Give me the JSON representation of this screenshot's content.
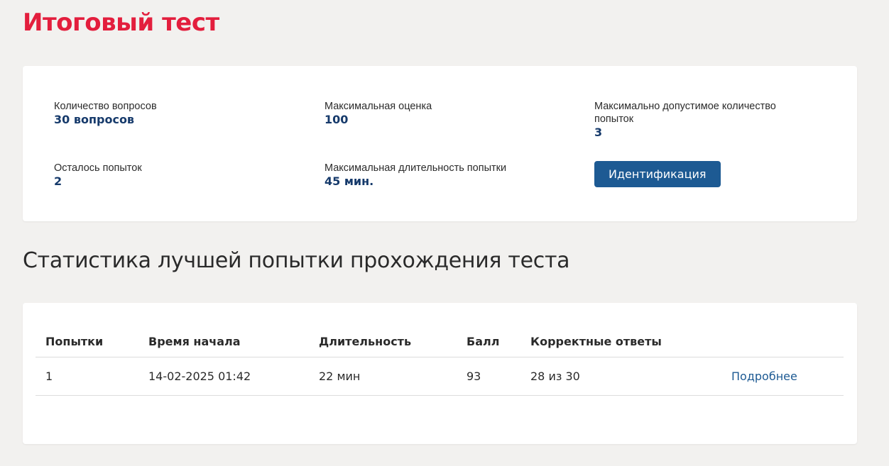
{
  "page": {
    "title": "Итоговый тест"
  },
  "info": {
    "questions_label": "Количество вопросов",
    "questions_value": "30 вопросов",
    "max_score_label": "Максимальная оценка",
    "max_score_value": "100",
    "max_attempts_label": "Максимально допустимое количество попыток",
    "max_attempts_value": "3",
    "remaining_label": "Осталось попыток",
    "remaining_value": "2",
    "max_duration_label": "Максимальная длительность попытки",
    "max_duration_value": "45 мин.",
    "identify_button": "Идентификация"
  },
  "stats": {
    "title": "Статистика лучшей попытки прохождения теста",
    "columns": [
      "Попытки",
      "Время начала",
      "Длительность",
      "Балл",
      "Корректные ответы",
      ""
    ],
    "rows": [
      {
        "attempt": "1",
        "start": "14-02-2025 01:42",
        "duration": "22 мин",
        "score": "93",
        "correct": "28 из 30",
        "details": "Подробнее"
      }
    ]
  },
  "colors": {
    "title_red": "#e31e3d",
    "value_blue": "#163a6b",
    "button_blue": "#1d5a93",
    "background": "#f2f1ef"
  }
}
